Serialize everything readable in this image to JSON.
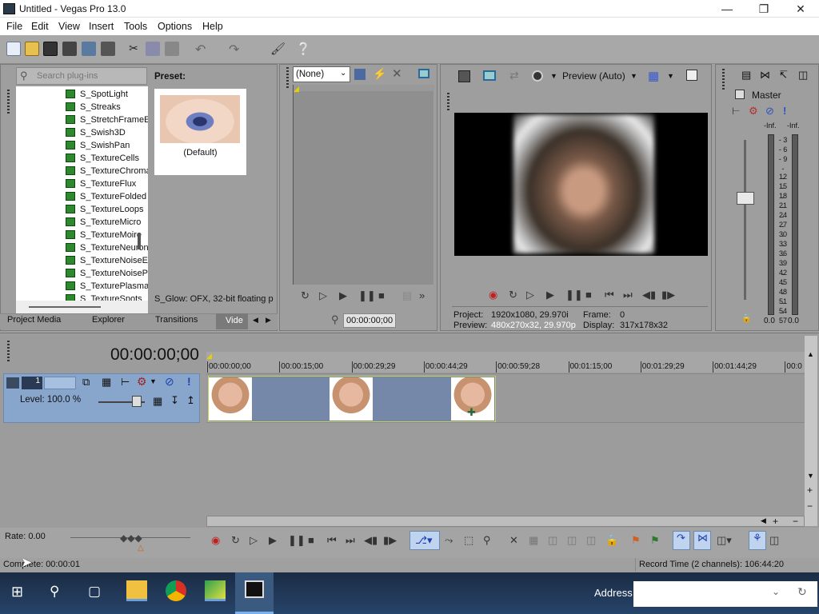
{
  "window": {
    "title": "Untitled - Vegas Pro 13.0"
  },
  "menu": [
    "File",
    "Edit",
    "View",
    "Insert",
    "Tools",
    "Options",
    "Help"
  ],
  "plugins": {
    "search_placeholder": "Search plug-ins",
    "items": [
      "S_SpotLight",
      "S_Streaks",
      "S_StretchFrameEd",
      "S_Swish3D",
      "S_SwishPan",
      "S_TextureCells",
      "S_TextureChroma",
      "S_TextureFlux",
      "S_TextureFolded",
      "S_TextureLoops",
      "S_TextureMicro",
      "S_TextureMoire",
      "S_TextureNeuron",
      "S_TextureNoiseEn",
      "S_TextureNoisePa",
      "S_TexturePlasma",
      "S_TextureSpots"
    ],
    "preset_label": "Preset:",
    "preset_name": "(Default)",
    "status": "S_Glow: OFX, 32-bit floating p"
  },
  "tabs": [
    "Project Media",
    "Explorer",
    "Transitions",
    "Vide"
  ],
  "trimmer": {
    "select": "(None)",
    "timecode": "00:00:00;00"
  },
  "preview": {
    "mode": "Preview (Auto)",
    "project_label": "Project:",
    "project_value": "1920x1080, 29.970i",
    "preview_label": "Preview:",
    "preview_value": "480x270x32, 29.970p",
    "frame_label": "Frame:",
    "frame_value": "0",
    "display_label": "Display:",
    "display_value": "317x178x32"
  },
  "master": {
    "title": "Master",
    "inf_left": "-Inf.",
    "inf_right": "-Inf.",
    "ticks": [
      "3",
      "6",
      "9",
      "12",
      "15",
      "18",
      "21",
      "24",
      "27",
      "30",
      "33",
      "36",
      "39",
      "42",
      "45",
      "48",
      "51",
      "54",
      "57"
    ],
    "val_left": "0.0",
    "val_right": "0.0"
  },
  "timeline": {
    "timecode": "00:00:00;00",
    "track_number": "1",
    "level": "Level: 100.0 %",
    "ruler": [
      "00:00:00;00",
      "00:00:15;00",
      "00:00:29;29",
      "00:00:44;29",
      "00:00:59;28",
      "00:01:15;00",
      "00:01:29;29",
      "00:01:44;29",
      "00:0"
    ]
  },
  "footer": {
    "rate": "Rate: 0.00",
    "complete": "Complete: 00:00:01",
    "record_time": "Record Time (2 channels): 106:44:20"
  },
  "taskbar": {
    "address_label": "Address"
  }
}
